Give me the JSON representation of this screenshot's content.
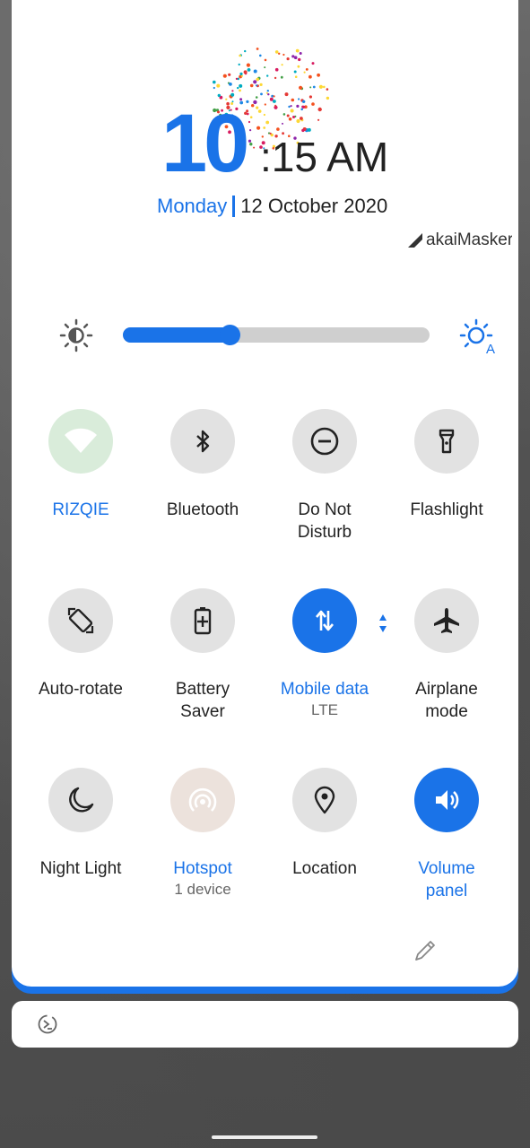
{
  "clock": {
    "hour": "10",
    "minutes": ":15 AM"
  },
  "date": {
    "day": "Monday",
    "text": "12 October 2020"
  },
  "brand": {
    "text": "akaiMasker"
  },
  "brightness": {
    "level": 0.35
  },
  "tiles": [
    {
      "label": "RIZQIE",
      "sub": "",
      "state": "on",
      "icon": "wifi-icon"
    },
    {
      "label": "Bluetooth",
      "sub": "",
      "state": "off",
      "icon": "bluetooth-icon"
    },
    {
      "label": "Do Not\nDisturb",
      "sub": "",
      "state": "off",
      "icon": "do-not-disturb-icon"
    },
    {
      "label": "Flashlight",
      "sub": "",
      "state": "off",
      "icon": "flashlight-icon"
    },
    {
      "label": "Auto-rotate",
      "sub": "",
      "state": "off",
      "icon": "auto-rotate-icon"
    },
    {
      "label": "Battery\nSaver",
      "sub": "",
      "state": "off",
      "icon": "battery-saver-icon"
    },
    {
      "label": "Mobile data",
      "sub": "LTE",
      "state": "on",
      "icon": "mobile-data-icon"
    },
    {
      "label": "Airplane\nmode",
      "sub": "",
      "state": "off",
      "icon": "airplane-icon"
    },
    {
      "label": "Night Light",
      "sub": "",
      "state": "off",
      "icon": "night-light-icon"
    },
    {
      "label": "Hotspot",
      "sub": "1 device",
      "state": "on",
      "icon": "hotspot-icon"
    },
    {
      "label": "Location",
      "sub": "",
      "state": "off",
      "icon": "location-icon"
    },
    {
      "label": "Volume\npanel",
      "sub": "",
      "state": "on",
      "icon": "volume-icon"
    }
  ],
  "colors": {
    "accent": "#1a73e8",
    "tile_off": "#e2e2e2",
    "wifi_on": "#d9ecda"
  }
}
